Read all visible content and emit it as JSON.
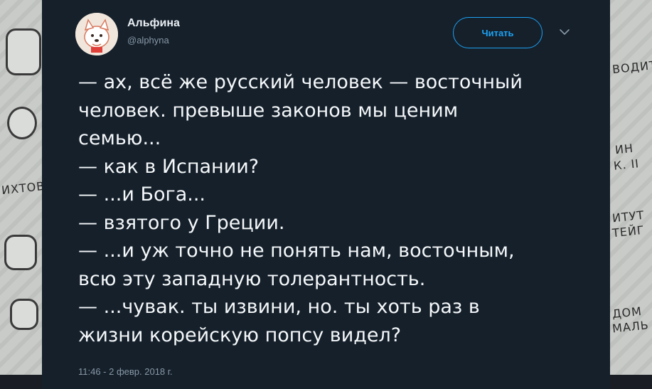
{
  "author": {
    "name": "Альфина",
    "handle": "@alphyna"
  },
  "follow_button": {
    "label": "Читать"
  },
  "tweet": {
    "lines": [
      "— ах, всё же русский человек — восточный",
      "человек. превыше законов мы ценим",
      "семью...",
      "— как в Испании?",
      "— ...и Бога...",
      "— взятого у Греции.",
      "— ...и уж точно не понять нам, восточным,",
      "всю эту западную толерантность.",
      "— ...чувак. ты извини, но. ты хоть раз в",
      "жизни корейскую попсу видел?"
    ],
    "timestamp": "11:46 - 2 февр. 2018 г."
  },
  "background_art": {
    "left_text": "ИХТОВ",
    "right_texts": [
      "ВОДИТ",
      "ИН",
      "К. II",
      "ИТУТ",
      "ТЕЙГ",
      "ДОМ",
      "МАЛЬ"
    ]
  },
  "colors": {
    "card_bg": "#15202b",
    "accent": "#1da1f2",
    "text": "#f5f8fa",
    "muted": "#8899a6"
  },
  "icons": {
    "avatar": "cartoon-dog-avatar",
    "chevron": "chevron-down-icon"
  }
}
